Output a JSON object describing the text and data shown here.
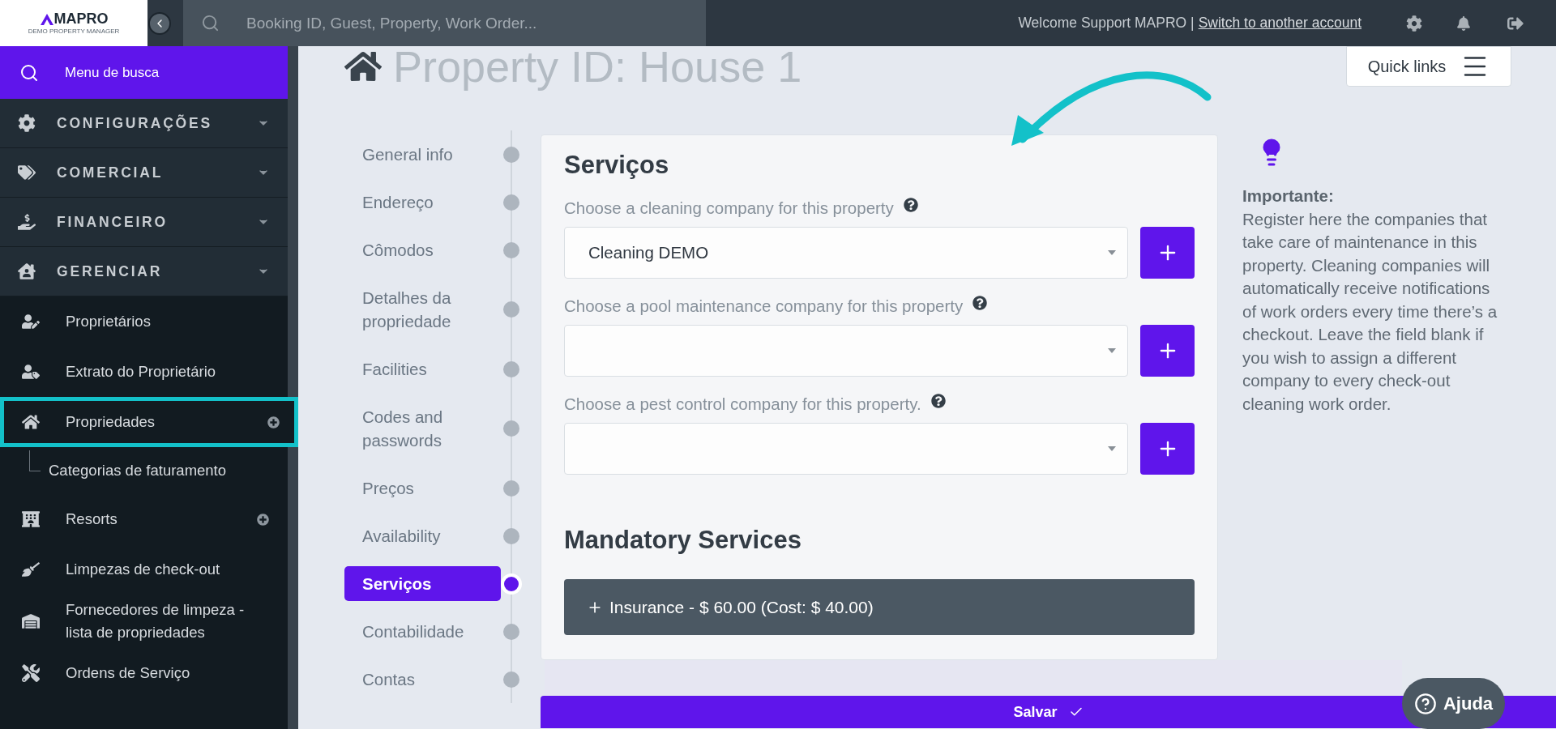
{
  "topbar": {
    "logo": {
      "name": "MAPRO",
      "tagline": "DEMO PROPERTY MANAGER"
    },
    "search": {
      "placeholder": "Booking ID, Guest, Property, Work Order..."
    },
    "welcome": "Welcome Support MAPRO |",
    "switch_link": "Switch to another account"
  },
  "sidebar": {
    "search_button": "Menu de busca",
    "sections": [
      {
        "label": "CONFIGURAÇÕES"
      },
      {
        "label": "COMERCIAL"
      },
      {
        "label": "FINANCEIRO"
      },
      {
        "label": "GERENCIAR",
        "children": [
          {
            "label": "Proprietários",
            "add_button": false,
            "highlighted": false
          },
          {
            "label": "Extrato do Proprietário",
            "add_button": false,
            "highlighted": false
          },
          {
            "label": "Propriedades",
            "add_button": true,
            "highlighted": true,
            "children": [
              {
                "label": "Categorias de faturamento"
              }
            ]
          },
          {
            "label": "Resorts",
            "add_button": true,
            "highlighted": false
          },
          {
            "label": "Limpezas de check-out",
            "add_button": false,
            "highlighted": false
          },
          {
            "label": "Fornecedores de limpeza - lista de propriedades",
            "add_button": false,
            "highlighted": false
          },
          {
            "label": "Ordens de Serviço",
            "add_button": false,
            "highlighted": false
          }
        ]
      }
    ]
  },
  "page": {
    "title": "Property ID: House 1",
    "quick_links": "Quick links"
  },
  "steps": [
    {
      "label": "General info",
      "selected": false
    },
    {
      "label": "Endereço",
      "selected": false
    },
    {
      "label": "Cômodos",
      "selected": false
    },
    {
      "label": "Detalhes da propriedade",
      "selected": false
    },
    {
      "label": "Facilities",
      "selected": false
    },
    {
      "label": "Codes and passwords",
      "selected": false
    },
    {
      "label": "Preços",
      "selected": false
    },
    {
      "label": "Availability",
      "selected": false
    },
    {
      "label": "Serviços",
      "selected": true
    },
    {
      "label": "Contabilidade",
      "selected": false
    },
    {
      "label": "Contas",
      "selected": false
    }
  ],
  "form": {
    "title": "Serviços",
    "fields": [
      {
        "label": "Choose a cleaning company for this property",
        "value": "Cleaning DEMO"
      },
      {
        "label": "Choose a pool maintenance company for this property"
      },
      {
        "label": "Choose a pest control company for this property."
      }
    ],
    "mandatory_title": "Mandatory Services",
    "mandatory_services": [
      {
        "label": "Insurance - $ 60.00 (Cost: $ 40.00)"
      }
    ]
  },
  "info": {
    "title": "Importante:",
    "text": "Register here the companies that take care of maintenance in this property. Cleaning companies will automatically receive notifications of work orders every time there’s a checkout. Leave the field blank if you wish to assign a different company to every check-out cleaning work order."
  },
  "save_button": "Salvar",
  "help_button": "Ajuda"
}
